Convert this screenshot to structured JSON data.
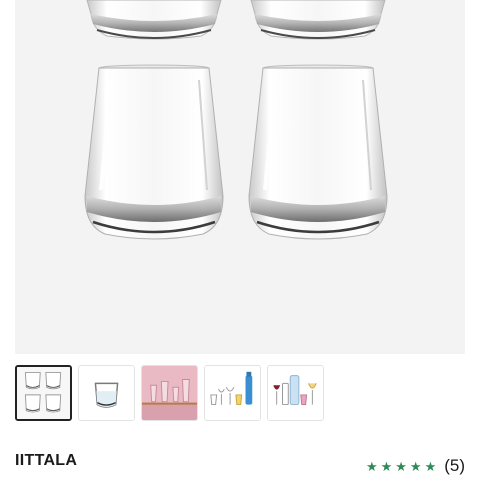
{
  "product": {
    "brand": "IITTALA",
    "rating_value": 5,
    "rating_max": 5,
    "review_count": "(5)"
  },
  "gallery": {
    "selected_index": 0,
    "thumbnails": [
      {
        "icon": "four-tumblers-thumbnail"
      },
      {
        "icon": "single-tumbler-thumbnail"
      },
      {
        "icon": "pink-glasses-thumbnail"
      },
      {
        "icon": "glass-collection-thumbnail"
      },
      {
        "icon": "carafe-and-wine-glasses-thumbnail"
      }
    ]
  },
  "colors": {
    "star": "#2e8b57",
    "selected_border": "#222222",
    "hero_background": "#f3f3f3"
  }
}
